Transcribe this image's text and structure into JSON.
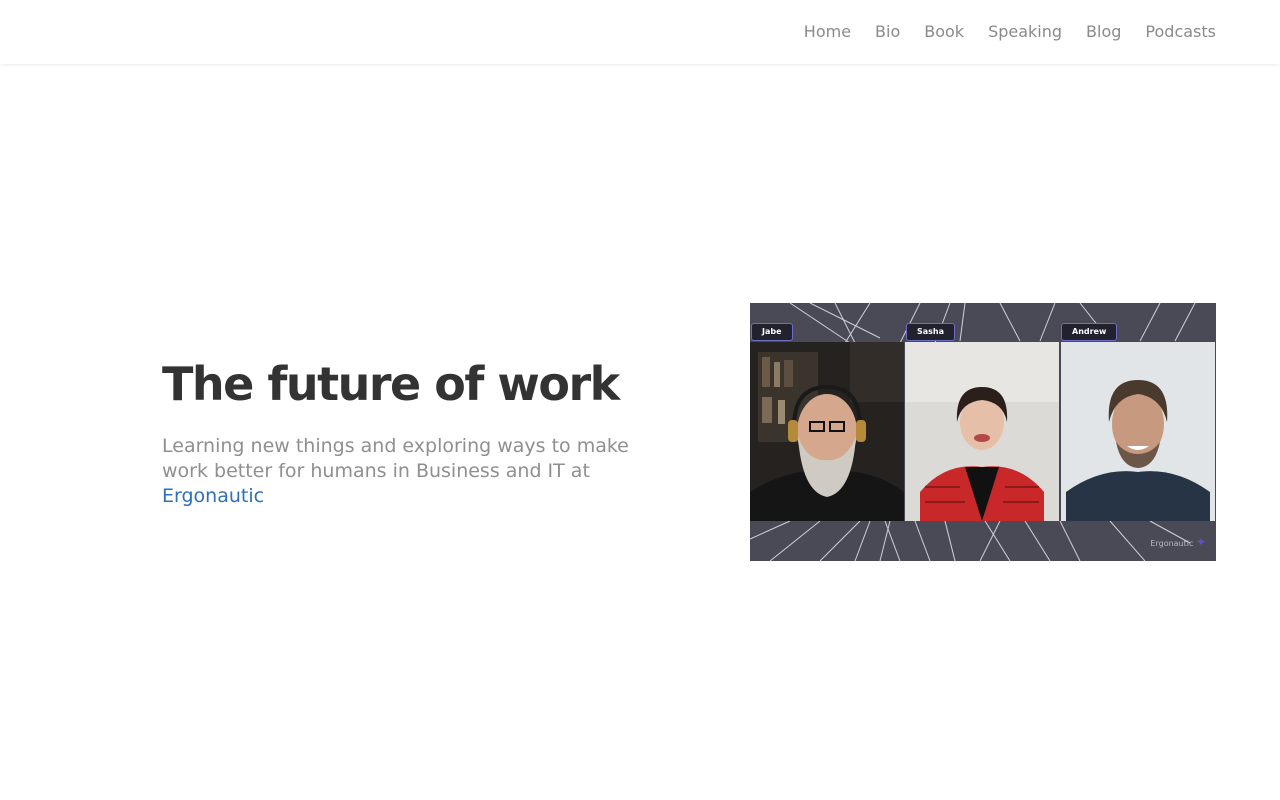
{
  "nav": {
    "items": [
      {
        "label": "Home"
      },
      {
        "label": "Bio"
      },
      {
        "label": "Book"
      },
      {
        "label": "Speaking"
      },
      {
        "label": "Blog"
      },
      {
        "label": "Podcasts"
      }
    ]
  },
  "hero": {
    "title": "The future of work",
    "subtitle": "Learning new things and exploring ways to make work better for humans in Business and IT at",
    "link_label": "Ergonautic"
  },
  "image": {
    "participants": [
      {
        "name": "Jabe"
      },
      {
        "name": "Sasha"
      },
      {
        "name": "Andrew"
      }
    ],
    "watermark": "Ergonautic"
  },
  "colors": {
    "link": "#2f6fb9",
    "title": "#333333",
    "nav_text": "#8a8a8a",
    "subtitle_text": "#8f8f8f",
    "image_background": "#4a4a56"
  }
}
